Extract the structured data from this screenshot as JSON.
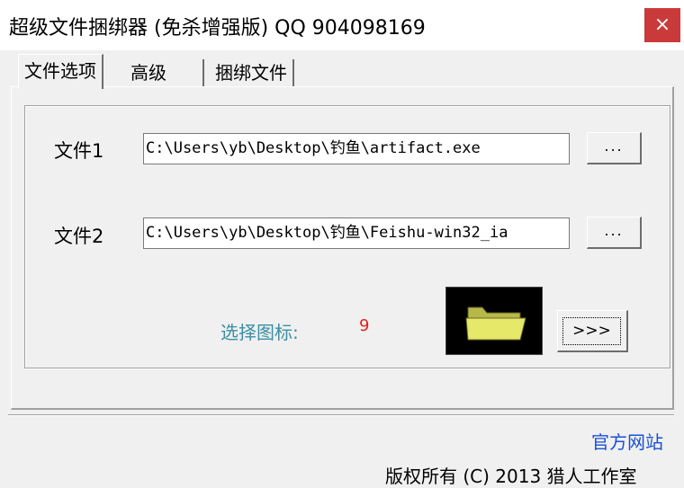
{
  "window": {
    "title": "超级文件捆绑器 (免杀增强版)  QQ 904098169",
    "close_label": "×"
  },
  "tabs": [
    {
      "label": "文件选项",
      "active": true
    },
    {
      "label": "高级",
      "active": false
    },
    {
      "label": "捆绑文件",
      "active": false
    }
  ],
  "files": {
    "file1": {
      "label": "文件1",
      "value": "C:\\Users\\yb\\Desktop\\钓鱼\\artifact.exe",
      "browse_label": "..."
    },
    "file2": {
      "label": "文件2",
      "value": "C:\\Users\\yb\\Desktop\\钓鱼\\Feishu-win32_ia",
      "browse_label": "..."
    }
  },
  "icon_select": {
    "label": "选择图标:",
    "count": "9",
    "icon": "folder-icon",
    "next_label": ">>>"
  },
  "footer": {
    "site_link": "官方网站",
    "copyright": "版权所有 (C) 2013 猎人工作室"
  },
  "colors": {
    "close": "#cb3a3a",
    "icon_label": "#3a8fa5",
    "count": "#e02020",
    "link": "#1a4fd8"
  }
}
